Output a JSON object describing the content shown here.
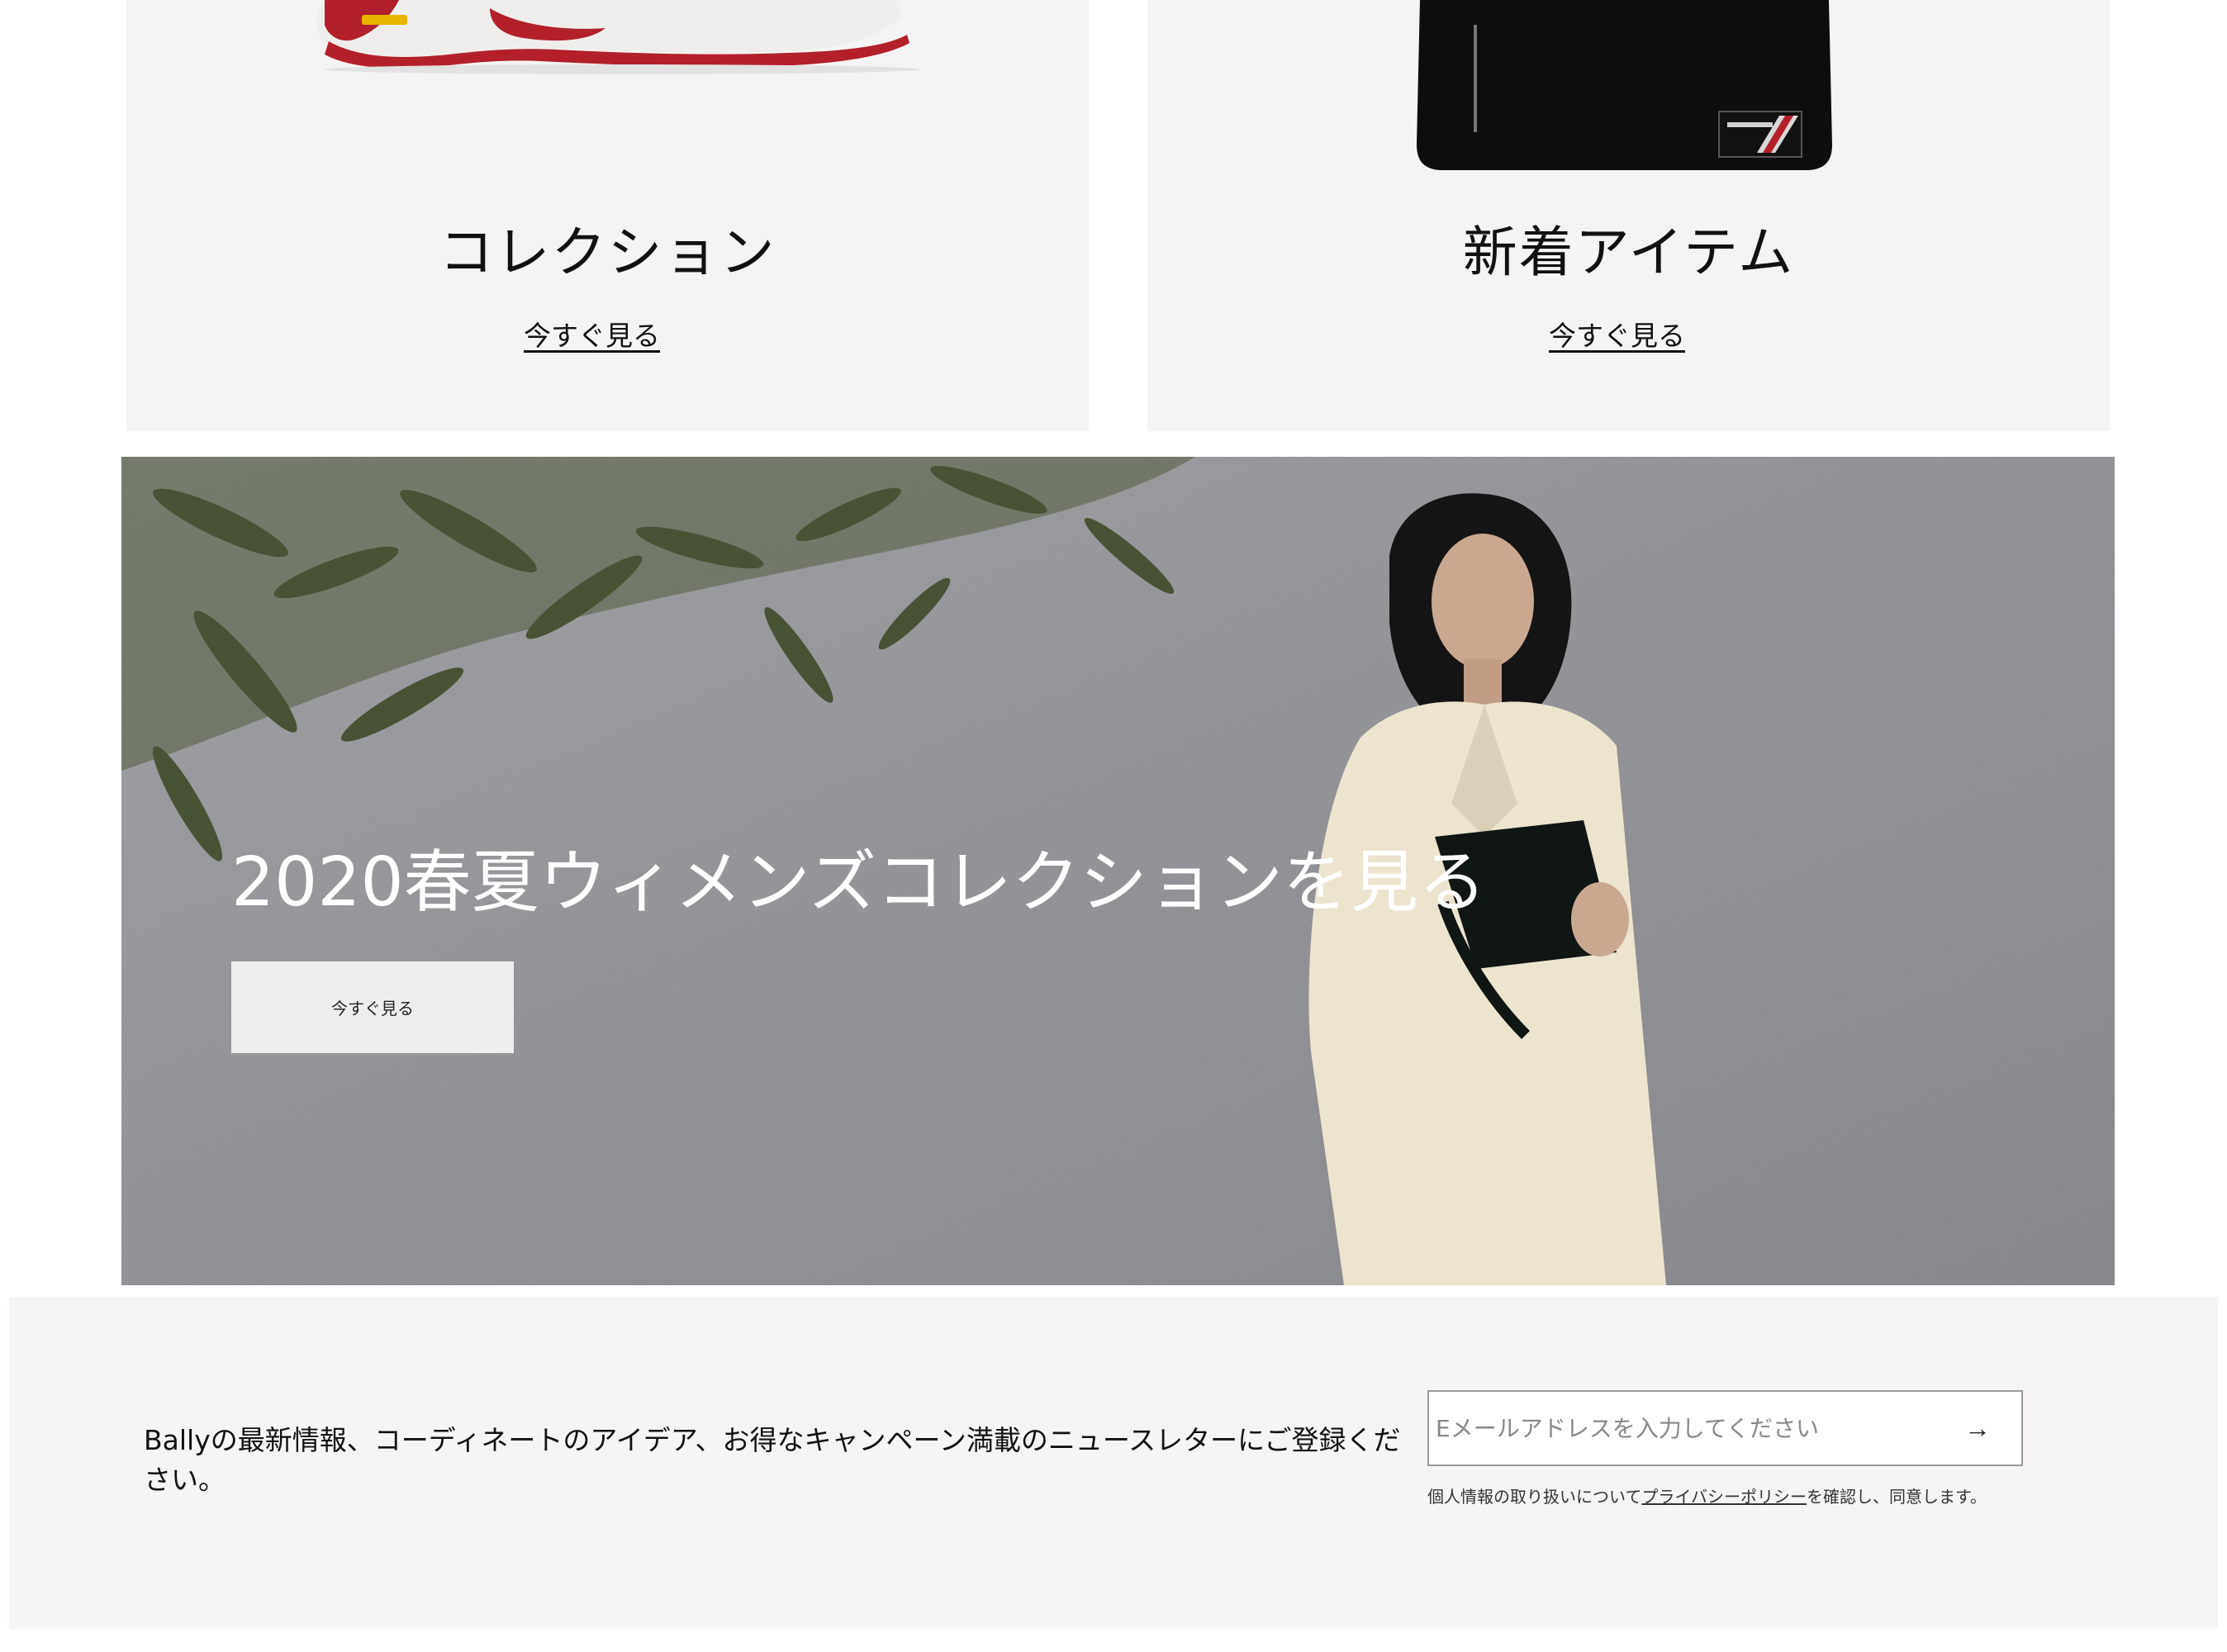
{
  "cards": [
    {
      "title": "コレクション",
      "link": "今すぐ見る",
      "image": "sneaker-image"
    },
    {
      "title": "新着アイテム",
      "link": "今すぐ見る",
      "image": "tote-bag-image"
    }
  ],
  "hero": {
    "title": "2020春夏ウィメンズコレクションを見る",
    "button": "今すぐ見る"
  },
  "newsletter": {
    "text": "Ballyの最新情報、コーディネートのアイデア、お得なキャンペーン満載のニュースレターにご登録ください。",
    "email_placeholder": "Eメールアドレスを入力してください",
    "submit_icon": "→",
    "privacy_prefix": "個人情報の取り扱いについて",
    "privacy_link": "プライバシーポリシー",
    "privacy_suffix": "を確認し、同意します。"
  }
}
